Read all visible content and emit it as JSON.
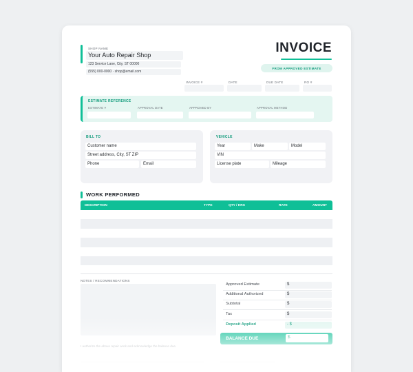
{
  "shop": {
    "label": "SHOP NAME",
    "name": "Your Auto Repair Shop",
    "address": "123 Service Lane, City, ST 00000",
    "contact": "(555) 000-0000 · shop@email.com"
  },
  "invoice": {
    "title": "INVOICE",
    "badge": "FROM APPROVED ESTIMATE",
    "meta_labels": [
      "INVOICE #",
      "DATE",
      "DUE DATE",
      "RO #"
    ]
  },
  "estimate_ref": {
    "title": "ESTIMATE REFERENCE",
    "labels": [
      "ESTIMATE #",
      "APPROVAL DATE",
      "APPROVED BY",
      "APPROVAL METHOD"
    ]
  },
  "bill_to": {
    "title": "BILL TO",
    "customer_name": "Customer name",
    "street": "Street address, City, ST ZIP",
    "phone": "Phone",
    "email": "Email"
  },
  "vehicle": {
    "title": "VEHICLE",
    "year": "Year",
    "make": "Make",
    "model": "Model",
    "vin": "VIN",
    "plate": "License plate",
    "mileage": "Mileage"
  },
  "work": {
    "title": "WORK PERFORMED",
    "columns": [
      "DESCRIPTION",
      "TYPE",
      "QTY / HRS",
      "RATE",
      "AMOUNT"
    ]
  },
  "notes": {
    "label": "NOTES / RECOMMENDATIONS"
  },
  "totals": {
    "approved_estimate": "Approved Estimate",
    "additional_authorized": "Additional Authorized",
    "subtotal": "Subtotal",
    "tax": "Tax",
    "deposit_applied": "Deposit Applied",
    "balance_due": "BALANCE DUE",
    "currency": "$",
    "deposit_currency": "- $"
  },
  "footer": {
    "acknowledgement": "I authorize the above repair work and acknowledge the balance due."
  },
  "colors": {
    "accent": "#0fbf97",
    "accent_dark": "#0e9a7a",
    "accent_light": "#e3f6f1",
    "panel": "#f1f2f5"
  }
}
